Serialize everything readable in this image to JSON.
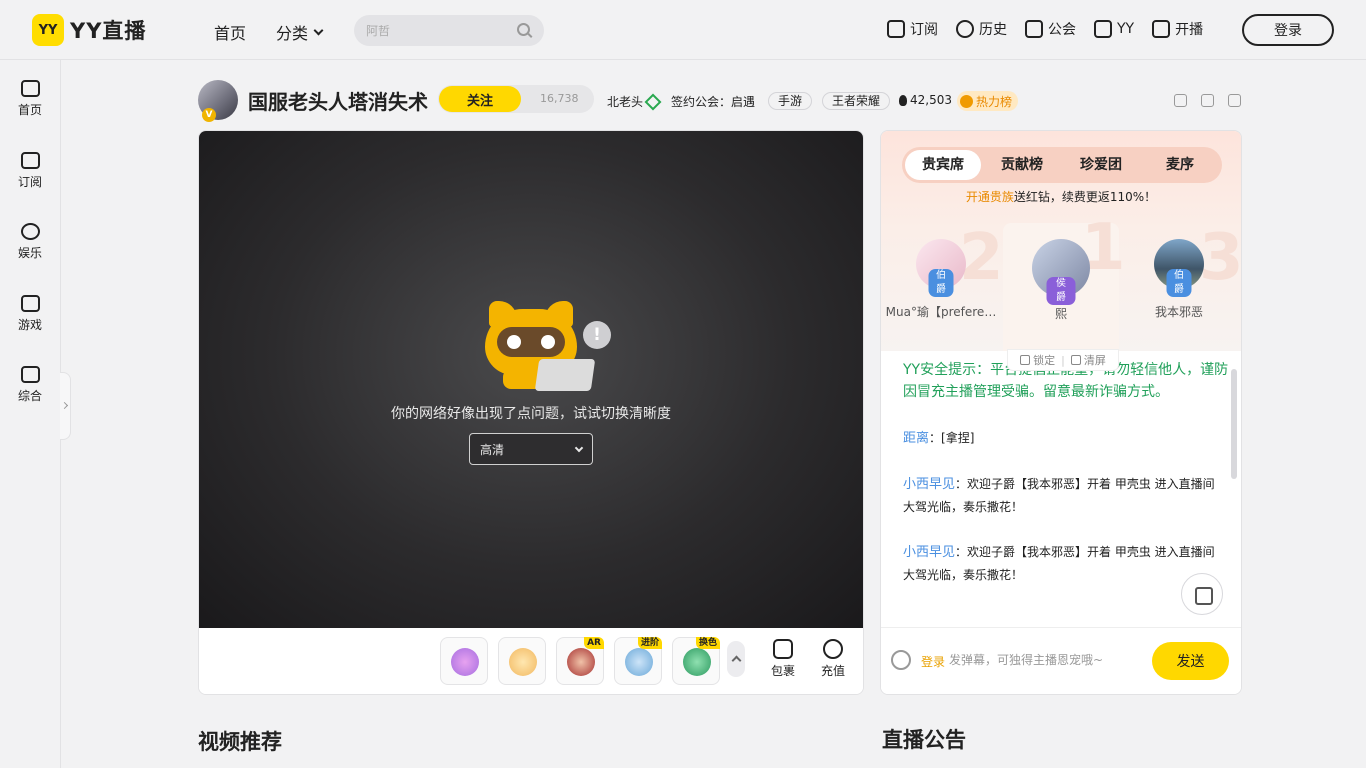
{
  "header": {
    "logo_badge": "YY",
    "logo_text": "YY直播",
    "nav_home": "首页",
    "nav_category": "分类",
    "search_placeholder": "阿哲",
    "links": [
      "订阅",
      "历史",
      "公会",
      "YY",
      "开播"
    ],
    "login": "登录"
  },
  "sidebar": {
    "items": [
      "首页",
      "订阅",
      "娱乐",
      "游戏",
      "综合"
    ]
  },
  "room": {
    "title": "国服老头人塔消失术",
    "follow_label": "关注",
    "follow_count": "16,738",
    "anchor": "北老头",
    "guild": "签约公会：启遇",
    "tags": [
      "手游",
      "王者荣耀"
    ],
    "heat": "42,503",
    "hot_rank": "热力榜"
  },
  "player": {
    "error_message": "你的网络好像出现了点问题，试试切换清晰度",
    "quality": "高清",
    "gift_tags": [
      "AR",
      "进阶",
      "换色"
    ],
    "package_label": "包裹",
    "recharge_label": "充值"
  },
  "panel": {
    "tabs": [
      "贵宾席",
      "贡献榜",
      "珍爱团",
      "麦序"
    ],
    "promo_highlight": "开通贵族",
    "promo_text": "送红钻，续费更返110%！",
    "rank_nums": [
      "2",
      "1",
      "3"
    ],
    "ranks": [
      {
        "name": "Mua°瑜【prefere…",
        "level": "伯爵"
      },
      {
        "name": "熙",
        "level": "侯爵"
      },
      {
        "name": "我本邪恶",
        "level": "伯爵"
      }
    ],
    "tool_lock": "锁定",
    "tool_clear": "清屏",
    "safety_tip": "YY安全提示：平台提倡正能量，请勿轻信他人，谨防因冒充主播管理受骗。留意最新诈骗方式。",
    "messages": [
      {
        "user": "距离",
        "sep": "：",
        "text": "[拿捏]"
      },
      {
        "user": "小西早见",
        "sep": "：",
        "text": "欢迎子爵【我本邪恶】开着 甲壳虫 进入直播间 大驾光临，奏乐撒花！"
      },
      {
        "user": "小西早见",
        "sep": "：",
        "text": "欢迎子爵【我本邪恶】开着 甲壳虫 进入直播间 大驾光临，奏乐撒花！"
      }
    ],
    "input_login": "登录",
    "input_placeholder": "发弹幕，可独得主播恩宠哦~",
    "send": "发送"
  },
  "sections": {
    "video_recommend": "视频推荐",
    "announcement": "直播公告"
  },
  "colors": {
    "brand_yellow": "#ffd800",
    "safety_green": "#21a05a",
    "username_blue": "#4a8fe0",
    "promo_orange": "#e98a00"
  }
}
